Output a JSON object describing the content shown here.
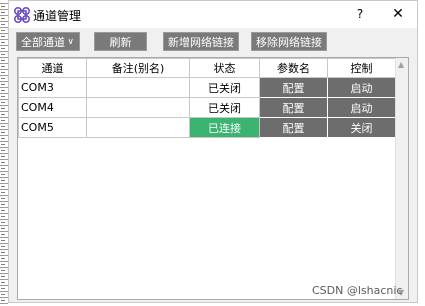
{
  "window": {
    "title": "通道管理",
    "help_label": "?",
    "close_label": "✕"
  },
  "toolbar": {
    "filter_value": "全部通道",
    "refresh_label": "刷新",
    "add_label": "新增网络链接",
    "remove_label": "移除网络链接"
  },
  "table": {
    "headers": [
      "通道",
      "备注(别名)",
      "状态",
      "参数名",
      "控制"
    ],
    "rows": [
      {
        "channel": "COM3",
        "alias": "",
        "status": "已关闭",
        "config": "配置",
        "control": "启动"
      },
      {
        "channel": "COM4",
        "alias": "",
        "status": "已关闭",
        "config": "配置",
        "control": "启动"
      },
      {
        "channel": "COM5",
        "alias": "",
        "status": "已连接",
        "config": "配置",
        "control": "关闭"
      }
    ]
  },
  "colors": {
    "connected": "#3cb371",
    "button": "#6d6d6d",
    "toolbar_button": "#7a7a7a"
  },
  "watermark": "CSDN @lshacnic"
}
